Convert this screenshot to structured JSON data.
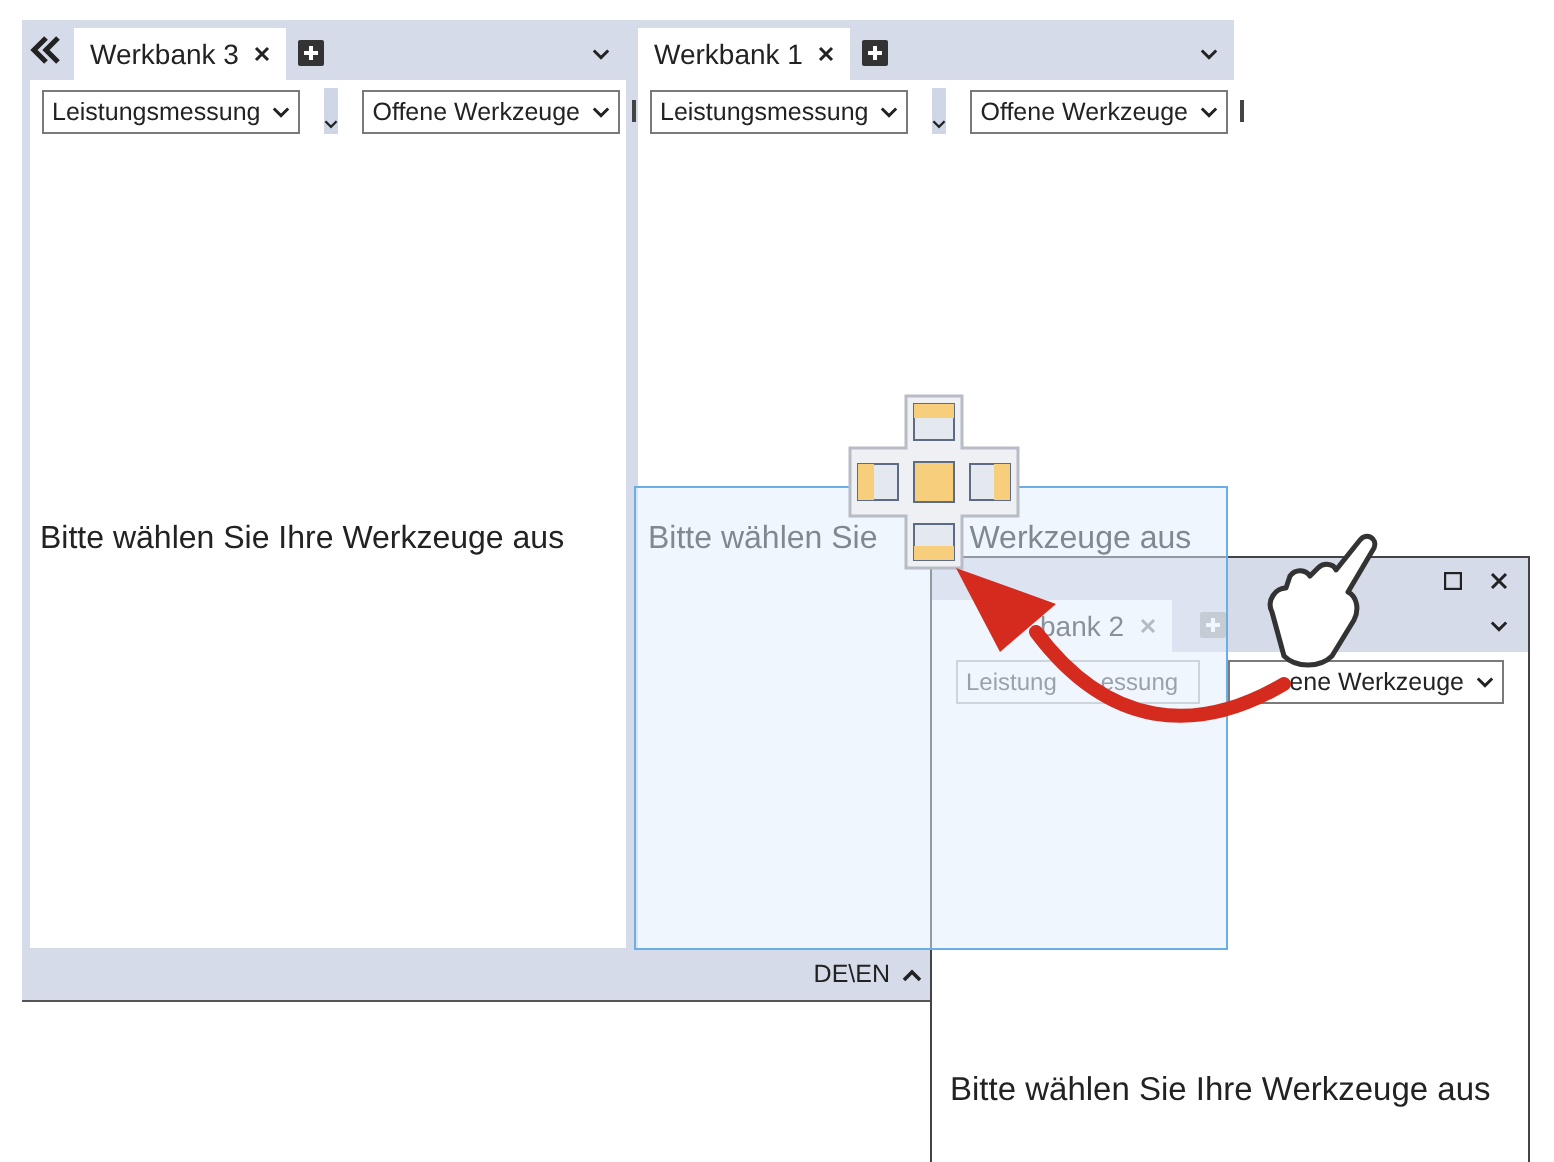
{
  "main_window": {
    "panes": [
      {
        "tab": {
          "label": "Werkbank 3",
          "selected": true
        },
        "dropdowns": [
          [
            "Leistungsmessung"
          ],
          [
            "Offene Werkzeuge"
          ]
        ],
        "message": [
          "Bitte wählen Sie Ihre Werkzeuge aus"
        ]
      },
      {
        "tab": {
          "label": "Werkbank 1",
          "selected": true
        },
        "dropdowns": [
          [
            "Leistungsmessung"
          ],
          [
            "Offene Werkzeuge"
          ]
        ],
        "message": [
          "Bitte wählen Sie",
          "Werkzeuge aus"
        ]
      }
    ],
    "status_bar": {
      "language": "DE\\EN"
    }
  },
  "floating_window": {
    "tab": {
      "label": "bank 2",
      "selected": true
    },
    "dropdowns": [
      [
        "Leistung",
        "essung"
      ],
      [
        "ene Werkzeuge"
      ]
    ],
    "message": [
      "Bitte wählen Sie Ihre Werkzeuge aus"
    ]
  }
}
